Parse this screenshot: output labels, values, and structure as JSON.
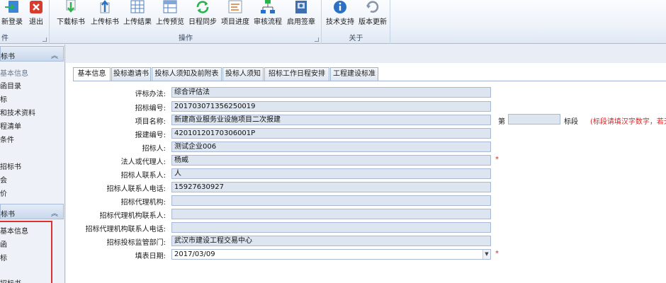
{
  "ribbon": {
    "groups": [
      {
        "label": "件",
        "buttons": [
          {
            "label": "新登录",
            "icon": "login-icon"
          },
          {
            "label": "退出",
            "icon": "close-icon"
          }
        ]
      },
      {
        "label": "操作",
        "buttons": [
          {
            "label": "下载标书",
            "icon": "download-icon"
          },
          {
            "label": "上传标书",
            "icon": "upload-icon"
          },
          {
            "label": "上传结果",
            "icon": "grid-icon"
          },
          {
            "label": "上传预览",
            "icon": "table-icon"
          },
          {
            "label": "日程同步",
            "icon": "sync-icon"
          },
          {
            "label": "项目进度",
            "icon": "progress-icon"
          },
          {
            "label": "审核流程",
            "icon": "workflow-icon"
          },
          {
            "label": "启用签章",
            "icon": "seal-icon"
          }
        ]
      },
      {
        "label": "关于",
        "buttons": [
          {
            "label": "技术支持",
            "icon": "info-icon"
          },
          {
            "label": "版本更新",
            "icon": "update-icon"
          }
        ]
      }
    ]
  },
  "sidebar": {
    "section1": {
      "title": "标书",
      "items": [
        "基本信息",
        "函目录",
        "标",
        "和技术资料",
        "程清单",
        "条件",
        "",
        "招标书",
        "会",
        "价"
      ]
    },
    "section2": {
      "title": "标书",
      "items": [
        "基本信息",
        "函",
        "标",
        "",
        "招标书"
      ]
    }
  },
  "tabs": [
    "基本信息",
    "投标邀请书",
    "投标人须知及前附表",
    "投标人须知",
    "招标工作日程安排",
    "工程建设标准"
  ],
  "form": {
    "fields": [
      {
        "label": "评标办法:",
        "value": "综合评估法"
      },
      {
        "label": "招标编号:",
        "value": "201703071356250019"
      },
      {
        "label": "项目名称:",
        "value": "新建商业服务业设施项目二次报建"
      },
      {
        "label": "报建编号:",
        "value": "42010120170306001P"
      },
      {
        "label": "招标人:",
        "value": "测试企业006"
      },
      {
        "label": "法人或代理人:",
        "value": "杨威",
        "required": "*"
      },
      {
        "label": "招标人联系人:",
        "value": "人"
      },
      {
        "label": "招标人联系人电话:",
        "value": "15927630927"
      },
      {
        "label": "招标代理机构:",
        "value": ""
      },
      {
        "label": "招标代理机构联系人:",
        "value": ""
      },
      {
        "label": "招标代理机构联系人电话:",
        "value": ""
      },
      {
        "label": "招标投标监管部门:",
        "value": "武汉市建设工程交易中心"
      },
      {
        "label": "填表日期:",
        "value": "2017/03/09",
        "required": "*"
      }
    ],
    "section_prefix": "第",
    "section_suffix": "标段",
    "section_note": "(标段请填汉字数字，若无",
    "section_value": ""
  },
  "colors": {
    "required": "#e02020",
    "input_bg": "#dde5f0",
    "highlight_box": "#e03030"
  }
}
